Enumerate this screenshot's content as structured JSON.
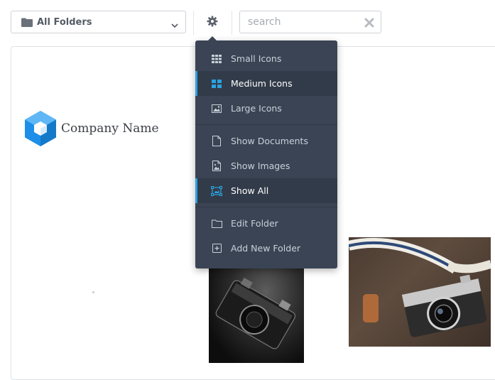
{
  "toolbar": {
    "folder_select": {
      "value": "All Folders"
    },
    "search": {
      "placeholder": "search"
    }
  },
  "content": {
    "logo": {
      "company_name": "Company Name"
    }
  },
  "settings_menu": {
    "groups": [
      [
        {
          "label": "Small Icons",
          "icon": "grid-small-icon",
          "active": false
        },
        {
          "label": "Medium Icons",
          "icon": "grid-medium-icon",
          "active": true
        },
        {
          "label": "Large Icons",
          "icon": "image-large-icon",
          "active": false
        }
      ],
      [
        {
          "label": "Show Documents",
          "icon": "document-icon",
          "active": false
        },
        {
          "label": "Show Images",
          "icon": "image-file-icon",
          "active": false
        },
        {
          "label": "Show All",
          "icon": "show-all-icon",
          "active": true
        }
      ],
      [
        {
          "label": "Edit Folder",
          "icon": "folder-outline-icon",
          "active": false
        },
        {
          "label": "Add New Folder",
          "icon": "plus-square-icon",
          "active": false
        }
      ]
    ]
  },
  "colors": {
    "menu_bg": "#3a4454",
    "accent": "#2aa3e0",
    "logo_blue": "#1d8fe8"
  }
}
